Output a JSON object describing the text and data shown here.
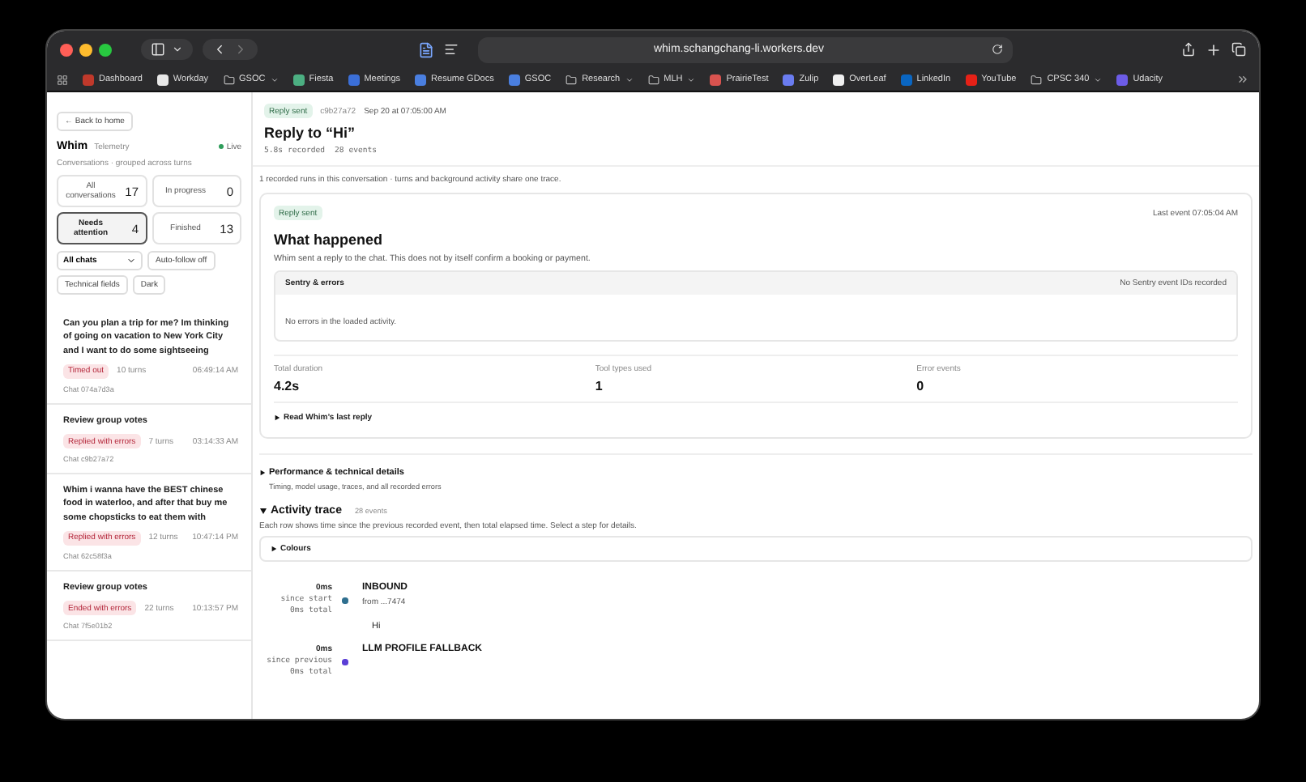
{
  "browser": {
    "url": "whim.schangchang-li.workers.dev",
    "bookmarks": [
      {
        "label": "Dashboard",
        "kind": "site",
        "color": "#c0392b"
      },
      {
        "label": "Workday",
        "kind": "site",
        "color": "#e8e8e8"
      },
      {
        "label": "GSOC",
        "kind": "folder"
      },
      {
        "label": "Fiesta",
        "kind": "site",
        "color": "#4caf82"
      },
      {
        "label": "Meetings",
        "kind": "site",
        "color": "#3b6fd8"
      },
      {
        "label": "Resume GDocs",
        "kind": "site",
        "color": "#4a7fe0"
      },
      {
        "label": "GSOC",
        "kind": "site",
        "color": "#4a7fe0"
      },
      {
        "label": "Research",
        "kind": "folder"
      },
      {
        "label": "MLH",
        "kind": "folder"
      },
      {
        "label": "PrairieTest",
        "kind": "site",
        "color": "#d9534f"
      },
      {
        "label": "Zulip",
        "kind": "site",
        "color": "#6a7cf0"
      },
      {
        "label": "OverLeaf",
        "kind": "site",
        "color": "#f0f0f0"
      },
      {
        "label": "LinkedIn",
        "kind": "site",
        "color": "#0a66c2"
      },
      {
        "label": "YouTube",
        "kind": "site",
        "color": "#e62117"
      },
      {
        "label": "CPSC 340",
        "kind": "folder"
      },
      {
        "label": "Udacity",
        "kind": "site",
        "color": "#6c5ce7"
      }
    ]
  },
  "sidebar": {
    "back": "← Back to home",
    "app_name": "Whim",
    "app_subtitle": "Telemetry",
    "live": "Live",
    "caption": "Conversations · grouped across turns",
    "stats": [
      {
        "label": "All conversations",
        "count": "17",
        "selected": false
      },
      {
        "label": "In progress",
        "count": "0",
        "selected": false
      },
      {
        "label": "Needs attention",
        "count": "4",
        "selected": true
      },
      {
        "label": "Finished",
        "count": "13",
        "selected": false
      }
    ],
    "filter": "All chats",
    "buttons": [
      "Auto-follow off",
      "Technical fields",
      "Dark"
    ],
    "conversations": [
      {
        "title": "Can you plan a trip for me? Im thinking of going on vacation to New York City and I want to do some sightseeing",
        "status": "Timed out",
        "turns": "10 turns",
        "time": "06:49:14 AM",
        "chat": "Chat 074a7d3a"
      },
      {
        "title": "Review group votes",
        "status": "Replied with errors",
        "turns": "7 turns",
        "time": "03:14:33 AM",
        "chat": "Chat c9b27a72"
      },
      {
        "title": "Whim i wanna have the BEST chinese food in waterloo, and after that buy me some chopsticks to eat them with",
        "status": "Replied with errors",
        "turns": "12 turns",
        "time": "10:47:14 PM",
        "chat": "Chat 62c58f3a"
      },
      {
        "title": "Review group votes",
        "status": "Ended with errors",
        "turns": "22 turns",
        "time": "10:13:57 PM",
        "chat": "Chat 7f5e01b2"
      }
    ]
  },
  "header": {
    "badge": {
      "label": "Reply sent",
      "kind": "success"
    },
    "id": "c9b27a72",
    "date": "Sep 20 at 07:05:00 AM",
    "title": "Reply to “Hi”",
    "meta": [
      "5.8s recorded",
      "28 events"
    ]
  },
  "note": "1 recorded runs in this conversation · turns and background activity share one trace.",
  "summary": {
    "badge": {
      "label": "Reply sent",
      "kind": "success"
    },
    "last_event": "Last event 07:05:04 AM",
    "heading": "What happened",
    "description": "Whim sent a reply to the chat. This does not by itself confirm a booking or payment.",
    "sentry": {
      "title": "Sentry & errors",
      "note": "No Sentry event IDs recorded",
      "body": "No errors in the loaded activity."
    },
    "metrics": [
      {
        "label": "Total duration",
        "value": "4.2s"
      },
      {
        "label": "Tool types used",
        "value": "1"
      },
      {
        "label": "Error events",
        "value": "0"
      }
    ],
    "last_reply": {
      "label": "Read Whim’s last reply",
      "expanded": false
    }
  },
  "performance": {
    "title": "Performance & technical details",
    "subtitle": "Timing, model usage, traces, and all recorded errors",
    "expanded": false
  },
  "activity": {
    "title": "Activity trace",
    "count": "28 events",
    "expanded": true,
    "description": "Each row shows time since the previous recorded event, then total elapsed time. Select a step for details.",
    "colours": {
      "label": "Colours",
      "expanded": false
    },
    "events": [
      {
        "delta": "0ms",
        "relation": "since start",
        "total": "0ms total",
        "title": "INBOUND",
        "detail": "from ...7474",
        "message": "Hi",
        "color": "#2f6f8f"
      },
      {
        "delta": "0ms",
        "relation": "since previous",
        "total": "0ms total",
        "title": "LLM PROFILE FALLBACK",
        "color": "#5b3fd6"
      }
    ]
  }
}
